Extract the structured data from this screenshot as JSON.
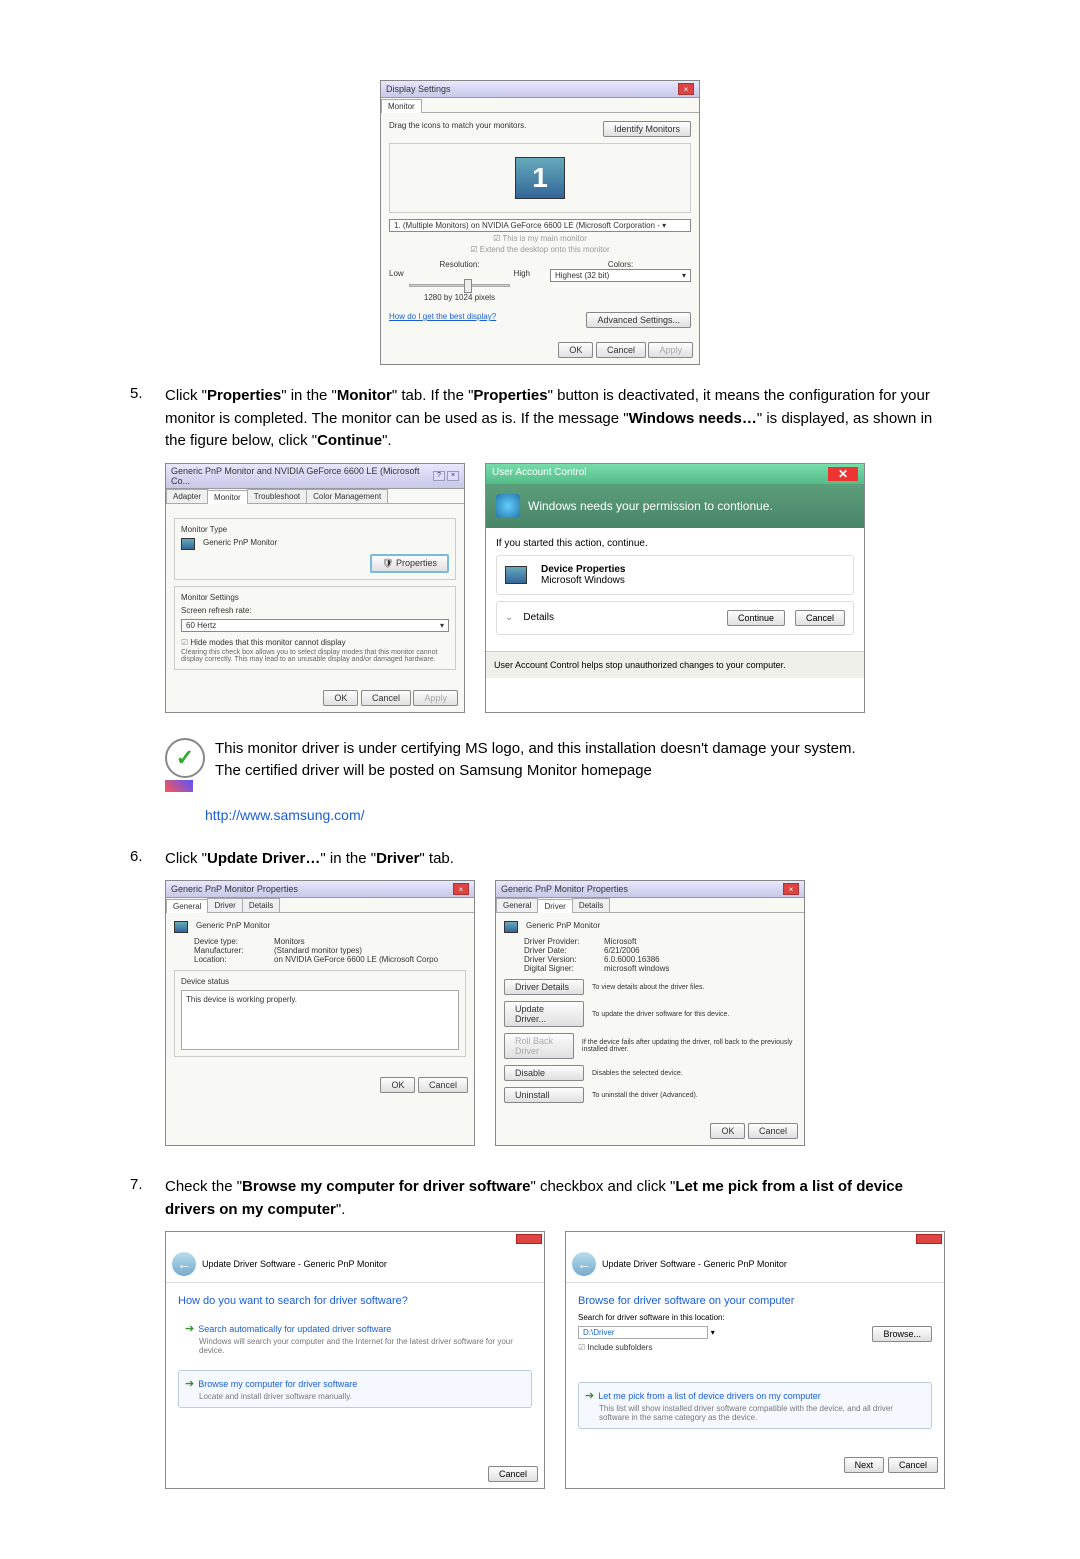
{
  "display_settings": {
    "title": "Display Settings",
    "tab": "Monitor",
    "instruction": "Drag the icons to match your monitors.",
    "identify_btn": "Identify Monitors",
    "monitor_number": "1",
    "dropdown": "1. (Multiple Monitors) on NVIDIA GeForce 6600 LE (Microsoft Corporation - ▾",
    "check1": "This is my main monitor",
    "check2": "Extend the desktop onto this monitor",
    "resolution_label": "Resolution:",
    "low": "Low",
    "high": "High",
    "res_value": "1280 by 1024 pixels",
    "colors_label": "Colors:",
    "colors_value": "Highest (32 bit)",
    "best_link": "How do I get the best display?",
    "advanced_btn": "Advanced Settings...",
    "ok": "OK",
    "cancel": "Cancel",
    "apply": "Apply"
  },
  "step5": {
    "num": "5.",
    "text_before": "Click \"",
    "prop": "Properties",
    "mid1": "\" in the \"",
    "monitor": "Monitor",
    "mid2": "\" tab. If the \"",
    "mid3": "\" button is deactivated, it means the configuration for your monitor is completed. The monitor can be used as is. If the message \"",
    "winneeds": "Windows needs…",
    "mid4": "\" is displayed, as shown in the figure below, click \"",
    "continue": "Continue",
    "end": "\"."
  },
  "monitor_props": {
    "title": "Generic PnP Monitor and NVIDIA GeForce 6600 LE (Microsoft Co...",
    "tab_adapter": "Adapter",
    "tab_monitor": "Monitor",
    "tab_trouble": "Troubleshoot",
    "tab_color": "Color Management",
    "section1": "Monitor Type",
    "monitor_name": "Generic PnP Monitor",
    "properties_btn": "Properties",
    "section2": "Monitor Settings",
    "refresh_label": "Screen refresh rate:",
    "refresh_value": "60 Hertz",
    "hide_check": "Hide modes that this monitor cannot display",
    "hide_desc": "Clearing this check box allows you to select display modes that this monitor cannot display correctly. This may lead to an unusable display and/or damaged hardware.",
    "ok": "OK",
    "cancel": "Cancel",
    "apply": "Apply"
  },
  "uac": {
    "title": "User Account Control",
    "banner": "Windows needs your permission to contionue.",
    "started": "If you started this action, continue.",
    "device_props": "Device Properties",
    "ms_windows": "Microsoft Windows",
    "details": "Details",
    "continue_btn": "Continue",
    "cancel_btn": "Cancel",
    "footer": "User Account Control helps stop unauthorized changes to your computer."
  },
  "note": {
    "line1": "This monitor driver is under certifying MS logo, and this installation doesn't damage your system.",
    "line2": "The certified driver will be posted on Samsung Monitor homepage"
  },
  "samsung_link": "http://www.samsung.com/",
  "step6": {
    "num": "6.",
    "part1": "Click \"",
    "update": "Update Driver…",
    "part2": "\" in the \"",
    "driver": "Driver",
    "part3": "\" tab."
  },
  "general_tab": {
    "title": "Generic PnP Monitor Properties",
    "tab_general": "General",
    "tab_driver": "Driver",
    "tab_details": "Details",
    "monitor_name": "Generic PnP Monitor",
    "device_type_l": "Device type:",
    "device_type_v": "Monitors",
    "manufacturer_l": "Manufacturer:",
    "manufacturer_v": "(Standard monitor types)",
    "location_l": "Location:",
    "location_v": "on NVIDIA GeForce 6600 LE (Microsoft Corpo",
    "status_l": "Device status",
    "status_v": "This device is working properly.",
    "ok": "OK",
    "cancel": "Cancel"
  },
  "driver_tab": {
    "title": "Generic PnP Monitor Properties",
    "tab_general": "General",
    "tab_driver": "Driver",
    "tab_details": "Details",
    "monitor_name": "Generic PnP Monitor",
    "provider_l": "Driver Provider:",
    "provider_v": "Microsoft",
    "date_l": "Driver Date:",
    "date_v": "6/21/2006",
    "version_l": "Driver Version:",
    "version_v": "6.0.6000.16386",
    "signer_l": "Digital Signer:",
    "signer_v": "microsoft windows",
    "btn_details": "Driver Details",
    "btn_details_d": "To view details about the driver files.",
    "btn_update": "Update Driver...",
    "btn_update_d": "To update the driver software for this device.",
    "btn_rollback": "Roll Back Driver",
    "btn_rollback_d": "If the device fails after updating the driver, roll back to the previously installed driver.",
    "btn_disable": "Disable",
    "btn_disable_d": "Disables the selected device.",
    "btn_uninstall": "Uninstall",
    "btn_uninstall_d": "To uninstall the driver (Advanced).",
    "ok": "OK",
    "cancel": "Cancel"
  },
  "step7": {
    "num": "7.",
    "part1": "Check the \"",
    "browse": "Browse my computer for driver software",
    "part2": "\" checkbox and click \"",
    "letme": "Let me pick from a list of device drivers on my computer",
    "part3": "\"."
  },
  "wizard1": {
    "breadcrumb": "Update Driver Software - Generic PnP Monitor",
    "heading": "How do you want to search for driver software?",
    "opt1": "Search automatically for updated driver software",
    "opt1_sub": "Windows will search your computer and the Internet for the latest driver software for your device.",
    "opt2": "Browse my computer for driver software",
    "opt2_sub": "Locate and install driver software manually.",
    "cancel": "Cancel"
  },
  "wizard2": {
    "breadcrumb": "Update Driver Software - Generic PnP Monitor",
    "heading": "Browse for driver software on your computer",
    "search_label": "Search for driver software in this location:",
    "search_path": "D:\\Driver",
    "browse_btn": "Browse...",
    "include_sub": "Include subfolders",
    "opt1": "Let me pick from a list of device drivers on my computer",
    "opt1_sub": "This list will show installed driver software compatible with the device, and all driver software in the same category as the device.",
    "next": "Next",
    "cancel": "Cancel"
  }
}
